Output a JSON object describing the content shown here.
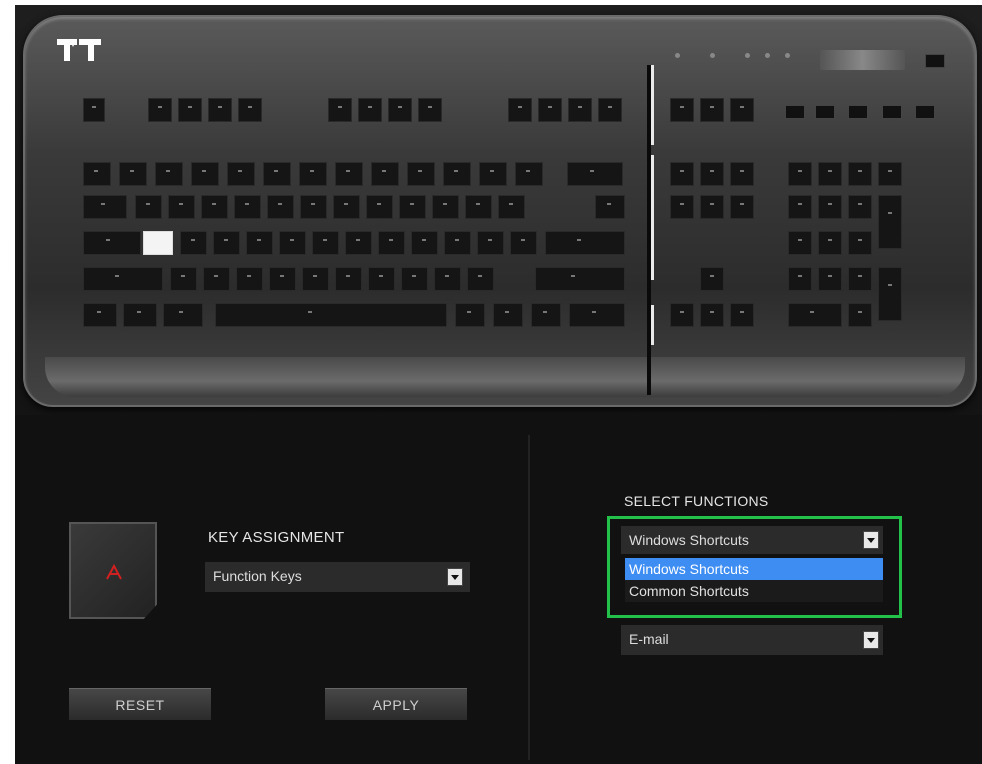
{
  "brand": {
    "logo": "TT"
  },
  "key_assignment": {
    "label": "KEY ASSIGNMENT",
    "value": "Function Keys",
    "key_glyph": "A"
  },
  "select_functions": {
    "label": "SELECT FUNCTIONS",
    "selected": "Windows Shortcuts",
    "options": [
      {
        "label": "Windows Shortcuts",
        "highlighted": true
      },
      {
        "label": "Common Shortcuts",
        "highlighted": false
      }
    ],
    "sub_value": "E-mail"
  },
  "buttons": {
    "reset": "RESET",
    "apply": "APPLY"
  },
  "colors": {
    "highlight_border": "#21c14a",
    "option_highlight": "#3d8df2",
    "key_accent": "#d02020"
  },
  "icons": {
    "dropdown_arrow": "chevron-down-icon",
    "key_icon": "keycap-icon"
  }
}
